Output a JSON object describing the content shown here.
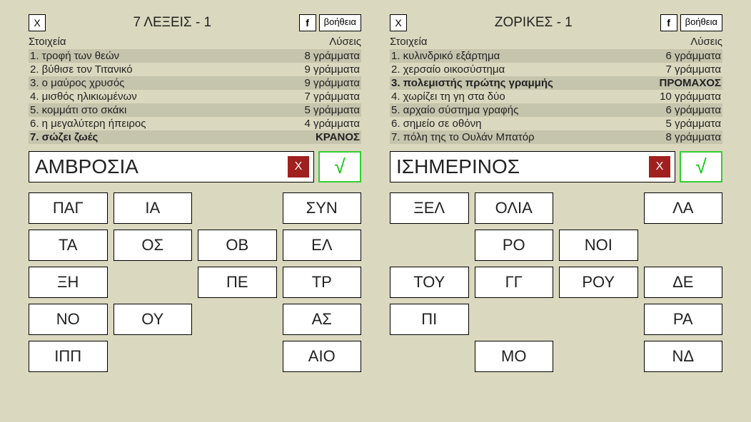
{
  "panels": [
    {
      "title": "7 ΛΕΞΕΙΣ - 1",
      "close": "X",
      "fb": "f",
      "help": "βοήθεια",
      "col_left": "Στοιχεία",
      "col_right": "Λύσεις",
      "clues": [
        {
          "n": "1.",
          "text": "τροφή των θεών",
          "sol": "8 γράμματα",
          "bold": false
        },
        {
          "n": "2.",
          "text": "βύθισε τον Τιτανικό",
          "sol": "9 γράμματα",
          "bold": false
        },
        {
          "n": "3.",
          "text": "ο μαύρος χρυσός",
          "sol": "9 γράμματα",
          "bold": false
        },
        {
          "n": "4.",
          "text": "μισθός ηλικιωμένων",
          "sol": "7 γράμματα",
          "bold": false
        },
        {
          "n": "5.",
          "text": "κομμάτι στο σκάκι",
          "sol": "5 γράμματα",
          "bold": false
        },
        {
          "n": "6.",
          "text": "η μεγαλύτερη ήπειρος",
          "sol": "4 γράμματα",
          "bold": false
        },
        {
          "n": "7.",
          "text": "σώζει ζωές",
          "sol": "ΚΡΑΝΟΣ",
          "bold": true
        }
      ],
      "input": "ΑΜΒΡΟΣΙΑ",
      "clear": "X",
      "submit": "√",
      "tiles": [
        [
          "ΠΑΓ",
          "ΙΑ",
          "",
          "ΣΥΝ"
        ],
        [
          "ΤΑ",
          "ΟΣ",
          "ΟΒ",
          "ΕΛ"
        ],
        [
          "ΞΗ",
          "",
          "ΠΕ",
          "ΤΡ"
        ],
        [
          "ΝΟ",
          "ΟΥ",
          "",
          "ΑΣ"
        ],
        [
          "ΙΠΠ",
          "",
          "",
          "ΑΙΟ"
        ]
      ]
    },
    {
      "title": "ΖΟΡΙΚΕΣ - 1",
      "close": "X",
      "fb": "f",
      "help": "βοήθεια",
      "col_left": "Στοιχεία",
      "col_right": "Λύσεις",
      "clues": [
        {
          "n": "1.",
          "text": "κυλινδρικό εξάρτημα",
          "sol": "6 γράμματα",
          "bold": false
        },
        {
          "n": "2.",
          "text": "χερσαίο οικοσύστημα",
          "sol": "7 γράμματα",
          "bold": false
        },
        {
          "n": "3.",
          "text": "πολεμιστής πρώτης γραμμής",
          "sol": "ΠΡΟΜΑΧΟΣ",
          "bold": true
        },
        {
          "n": "4.",
          "text": "χωρίζει τη γη στα δύο",
          "sol": "10 γράμματα",
          "bold": false
        },
        {
          "n": "5.",
          "text": "αρχαίο σύστημα γραφής",
          "sol": "6 γράμματα",
          "bold": false
        },
        {
          "n": "6.",
          "text": "σημείο σε οθόνη",
          "sol": "5 γράμματα",
          "bold": false
        },
        {
          "n": "7.",
          "text": "πόλη της το Ουλάν Μπατόρ",
          "sol": "8 γράμματα",
          "bold": false
        }
      ],
      "input": "ΙΣΗΜΕΡΙΝΟΣ",
      "clear": "X",
      "submit": "√",
      "tiles": [
        [
          "ΞΕΛ",
          "ΟΛΙΑ",
          "",
          "ΛΑ"
        ],
        [
          "",
          "ΡΟ",
          "ΝΟΙ",
          ""
        ],
        [
          "ΤΟΥ",
          "ΓΓ",
          "ΡΟΥ",
          "ΔΕ"
        ],
        [
          "ΠΙ",
          "",
          "",
          "ΡΑ"
        ],
        [
          "",
          "ΜΟ",
          "",
          "ΝΔ"
        ]
      ]
    }
  ]
}
